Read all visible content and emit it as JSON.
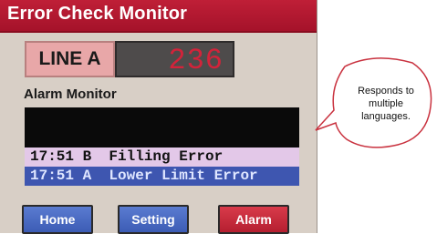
{
  "window": {
    "title": "Error Check Monitor"
  },
  "line": {
    "label": "LINE A",
    "count": "236"
  },
  "alarm_monitor": {
    "label": "Alarm Monitor",
    "rows": [
      {
        "text": ""
      },
      {
        "text": ""
      },
      {
        "text": "17:51 B  Filling Error"
      },
      {
        "text": "17:51 A  Lower Limit Error"
      }
    ]
  },
  "buttons": {
    "home": "Home",
    "setting": "Setting",
    "alarm": "Alarm"
  },
  "callout": {
    "text": "Responds to multiple languages."
  },
  "colors": {
    "title_bar": "#b5182f",
    "line_label_bg": "#e8a7a8",
    "counter_digits": "#d3233a",
    "alarm_highlight_1": "#e3c8e8",
    "alarm_highlight_2": "#3e56b0",
    "button_blue": "#4a6bc4",
    "button_red": "#c52a3b"
  }
}
